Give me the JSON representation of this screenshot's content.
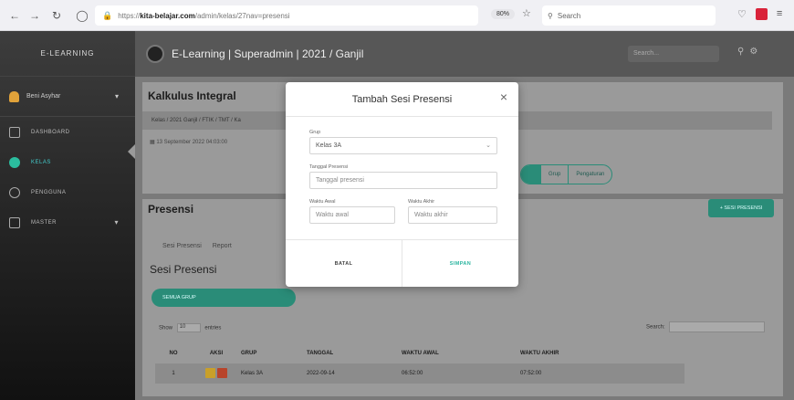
{
  "browser": {
    "url_prefix": "https://",
    "url_host": "kita-belajar.com",
    "url_path": "/admin/kelas/27nav=presensi",
    "zoom": "80%",
    "search_placeholder": "Search"
  },
  "sidebar": {
    "brand": "E-LEARNING",
    "user": "Beni Asyhar",
    "items": [
      {
        "label": "DASHBOARD"
      },
      {
        "label": "KELAS"
      },
      {
        "label": "PENGGUNA"
      },
      {
        "label": "MASTER"
      }
    ]
  },
  "topbar": {
    "title": "E-Learning | Superadmin | 2021 / Ganjil",
    "search_placeholder": "Search..."
  },
  "page": {
    "title": "Kalkulus Integral",
    "breadcrumb": "Kelas / 2021 Ganjil / FTIK / TMT / Ka",
    "date": "13 September 2022 04:03:00",
    "tabs": [
      "Grup",
      "Pengaturan"
    ],
    "section_title": "Presensi",
    "add_button": "+ SESI PRESENSI",
    "subtabs": [
      "Sesi Presensi",
      "Report"
    ],
    "sub_title": "Sesi Presensi",
    "semua_grup": "SEMUA GRUP",
    "show_label": "Show",
    "show_value": "10",
    "entries_label": "entries",
    "search_label": "Search:"
  },
  "table": {
    "headers": [
      "NO",
      "AKSI",
      "GRUP",
      "TANGGAL",
      "WAKTU AWAL",
      "WAKTU AKHIR"
    ],
    "rows": [
      {
        "no": "1",
        "grup": "Kelas 3A",
        "tanggal": "2022-09-14",
        "waktu_awal": "06:52:00",
        "waktu_akhir": "07:52:00"
      }
    ]
  },
  "modal": {
    "title": "Tambah Sesi Presensi",
    "grup_label": "Grup",
    "grup_value": "Kelas 3A",
    "tanggal_label": "Tanggal Presensi",
    "tanggal_placeholder": "Tanggal presensi",
    "awal_label": "Waktu Awal",
    "awal_placeholder": "Waktu awal",
    "akhir_label": "Waktu Akhir",
    "akhir_placeholder": "Waktu akhir",
    "cancel": "BATAL",
    "save": "SIMPAN"
  }
}
